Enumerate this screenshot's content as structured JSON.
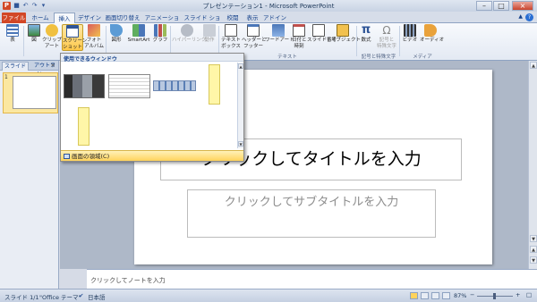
{
  "window": {
    "title": "プレゼンテーション1 - Microsoft PowerPoint",
    "app_icon": "P"
  },
  "tabs": {
    "file": "ファイル",
    "home": "ホーム",
    "insert": "挿入",
    "design": "デザイン",
    "transitions": "画面切り替え",
    "animations": "アニメーション",
    "slideshow": "スライド ショー",
    "review": "校閲",
    "view": "表示",
    "addins": "アドイン"
  },
  "ribbon": {
    "table": "表",
    "image": "図",
    "clipart": "クリップ\nアート",
    "screenshot": "スクリーン\nショット",
    "photo_album": "フォト\nアルバム",
    "shapes": "図形",
    "smartart": "SmartArt",
    "chart": "グラフ",
    "hyperlink": "ハイパーリンク",
    "action": "動作",
    "textbox": "テキスト\nボックス",
    "header_footer": "ヘッダーと\nフッター",
    "wordart": "ワードアート",
    "datetime": "日付と\n時刻",
    "slide_number": "スライド番号",
    "object": "オブジェクト",
    "equation": "数式",
    "symbol": "記号と\n特殊文字",
    "video": "ビデオ",
    "audio": "オーディオ",
    "group_text": "テキスト",
    "group_symbols": "記号と特殊文字",
    "group_media": "メディア"
  },
  "dropdown": {
    "header": "使用できるウィンドウ",
    "screen_clipping": "画面の領域(C)"
  },
  "left_pane": {
    "tab_slides": "スライド",
    "tab_outline": "アウトライン",
    "close": "×",
    "slide_number": "1"
  },
  "slide": {
    "title_placeholder": "クリックしてタイトルを入力",
    "subtitle_placeholder": "クリックしてサブタイトルを入力"
  },
  "notes": {
    "placeholder": "クリックしてノートを入力"
  },
  "status": {
    "slide_info": "スライド 1/1",
    "theme": "\"Office テーマ\"",
    "language": "日本語",
    "zoom": "87%"
  },
  "colors": {
    "accent": "#d24726",
    "ribbon_active": "#ffc84a"
  }
}
